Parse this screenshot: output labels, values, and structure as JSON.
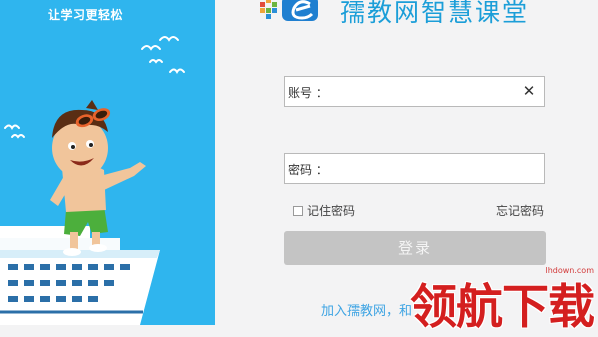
{
  "left_panel": {
    "slogan": "让学习更轻松"
  },
  "header": {
    "app_title": "孺教网智慧课堂"
  },
  "form": {
    "account_label": "账号 ：",
    "password_label": "密码 ：",
    "account_value": "",
    "password_value": "",
    "remember_label": "记住密码",
    "forgot_label": "忘记密码",
    "login_label": "登录",
    "join_text": "加入孺教网，和"
  },
  "watermark": {
    "site": "lhdown.com",
    "text": "领航下载"
  },
  "colors": {
    "panel_blue": "#2fb5ee",
    "title_blue": "#1b9ed8",
    "button_gray": "#c4c4c4",
    "watermark_red": "#d41f1f"
  }
}
